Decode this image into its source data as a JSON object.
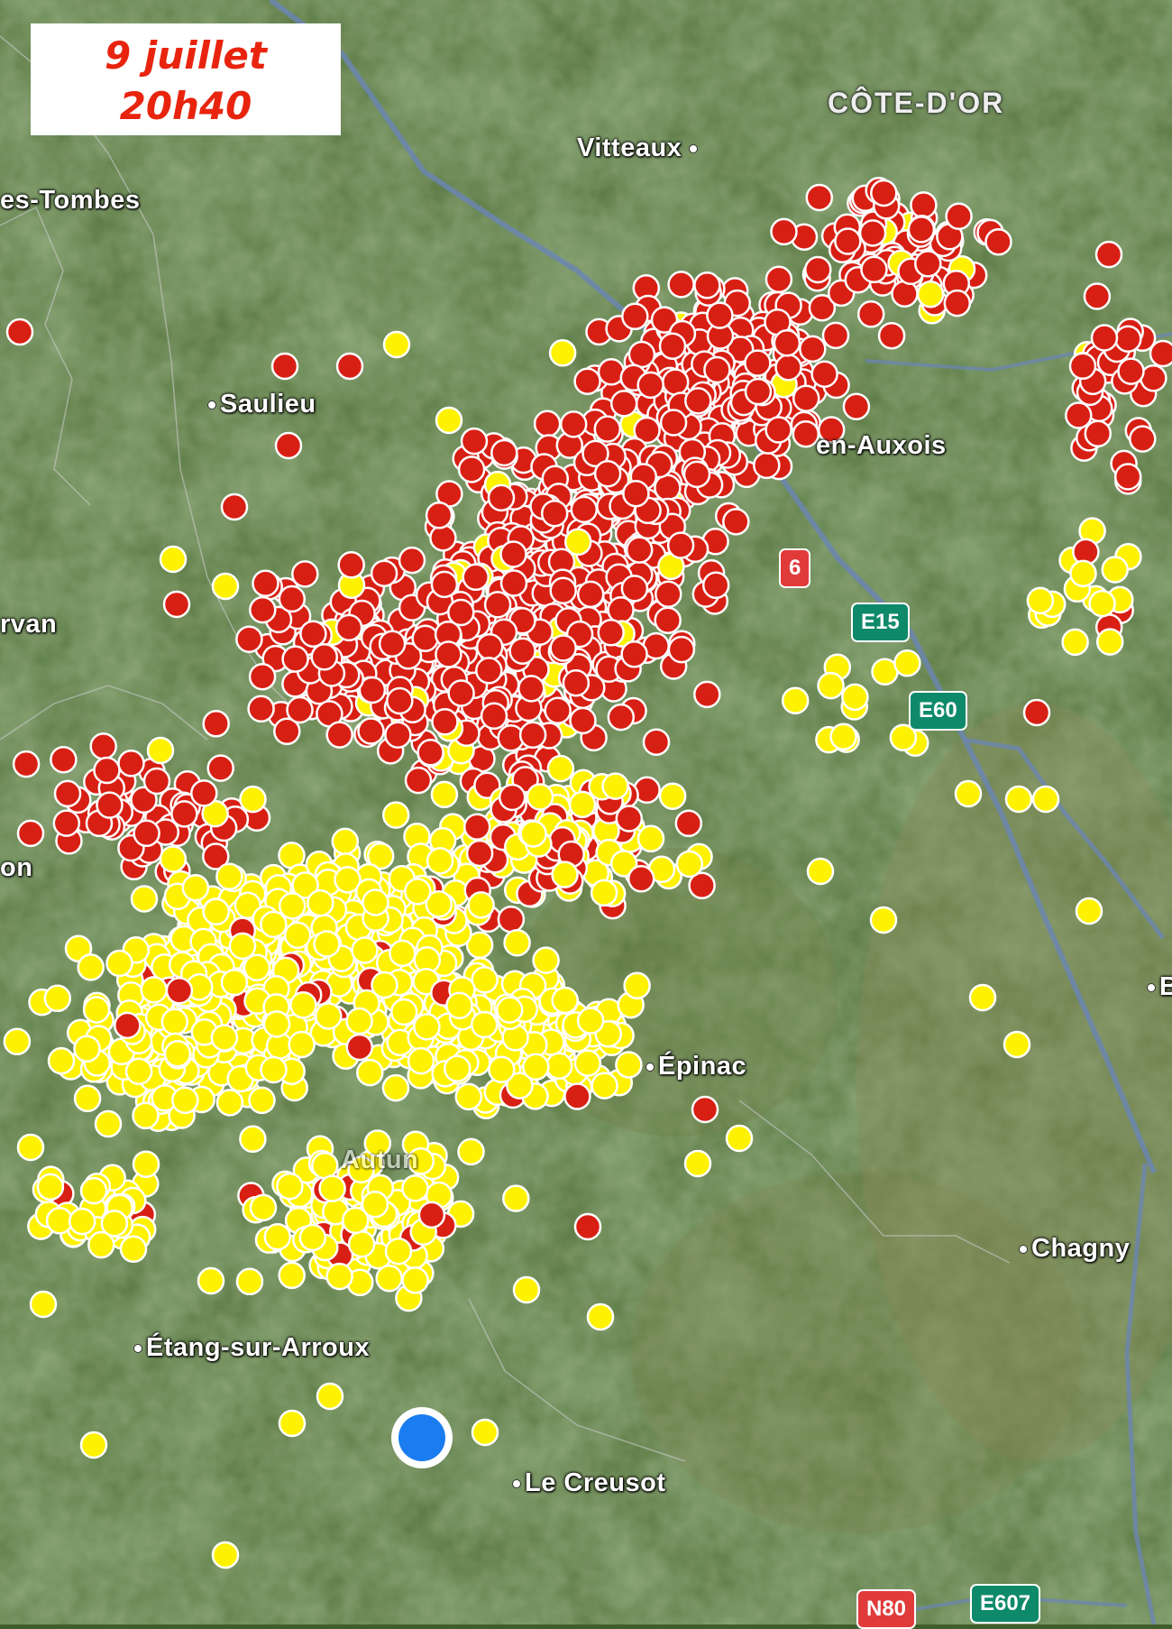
{
  "title": {
    "line1": "9 juillet",
    "line2": "20h40"
  },
  "region_label": "CÔTE-D'OR",
  "places": {
    "vitteaux": "Vitteaux",
    "tombes": "es-Tombes",
    "saulieu": "Saulieu",
    "auxois": "en-Auxois",
    "morvan": "rvan",
    "on": "on",
    "epinac": "Épinac",
    "chagny": "Chagny",
    "etang": "Étang-sur-Arroux",
    "creusot": "Le Creusot",
    "autun": "Autun",
    "edge_b": "B"
  },
  "roads": {
    "a6": "6",
    "e15": "E15",
    "e60": "E60",
    "n80": "N80",
    "e607": "E607"
  },
  "colors": {
    "red_marker": "#d81f14",
    "yellow_marker": "#fff200",
    "location": "#1a7cf0"
  },
  "marker_legend": {
    "red": "red-marker",
    "yellow": "yellow-marker"
  }
}
